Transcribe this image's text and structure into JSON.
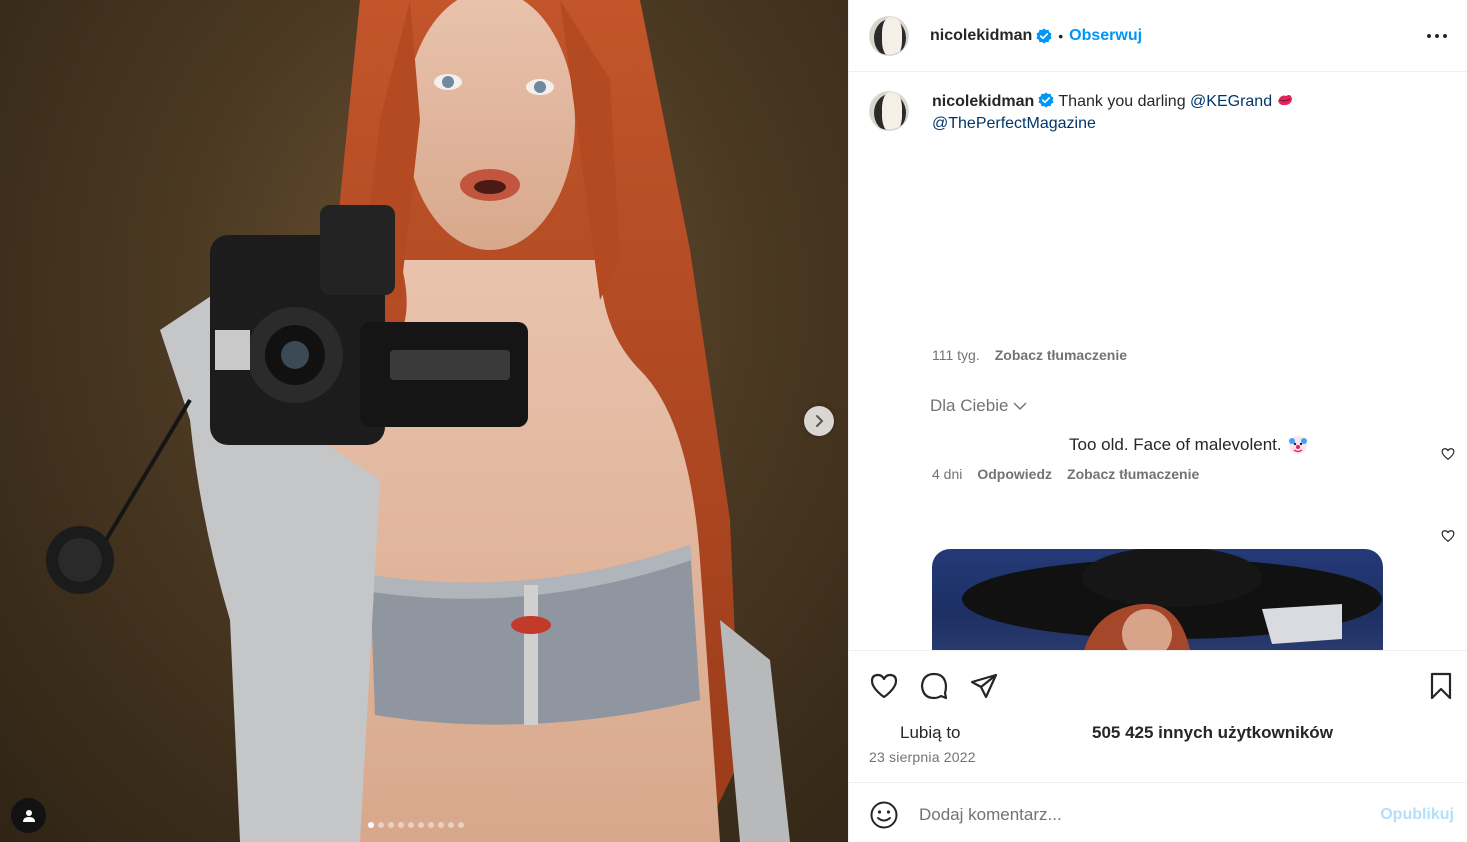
{
  "post": {
    "username": "nicolekidman",
    "follow_label": "Obserwuj",
    "separator": "•"
  },
  "caption": {
    "username": "nicolekidman",
    "text": "Thank you darling",
    "mention1": "@KEGrand",
    "mention2": "@ThePerfectMagazine",
    "age": "111 tyg.",
    "translate": "Zobacz tłumaczenie"
  },
  "filter": {
    "label": "Dla Ciebie"
  },
  "comment": {
    "text": "Too old. Face of malevolent.",
    "age": "4 dni",
    "reply": "Odpowiedz",
    "translate": "Zobacz tłumaczenie"
  },
  "likes": {
    "label": "Lubią to",
    "count": "505 425 innych użytkowników"
  },
  "date": "23 sierpnia 2022",
  "add_comment": {
    "placeholder": "Dodaj komentarz...",
    "publish": "Opublikuj"
  },
  "carousel": {
    "total": 10,
    "active_index": 0
  },
  "icons": {
    "heart": "heart-icon",
    "comment": "comment-icon",
    "share": "share-icon",
    "save": "bookmark-icon",
    "emoji": "emoji-icon",
    "next": "chevron-right-icon",
    "more": "more-options-icon",
    "verified": "verified-badge-icon"
  },
  "colors": {
    "accent": "#0095f6",
    "mention": "#00376b",
    "verified": "#0095f6"
  }
}
